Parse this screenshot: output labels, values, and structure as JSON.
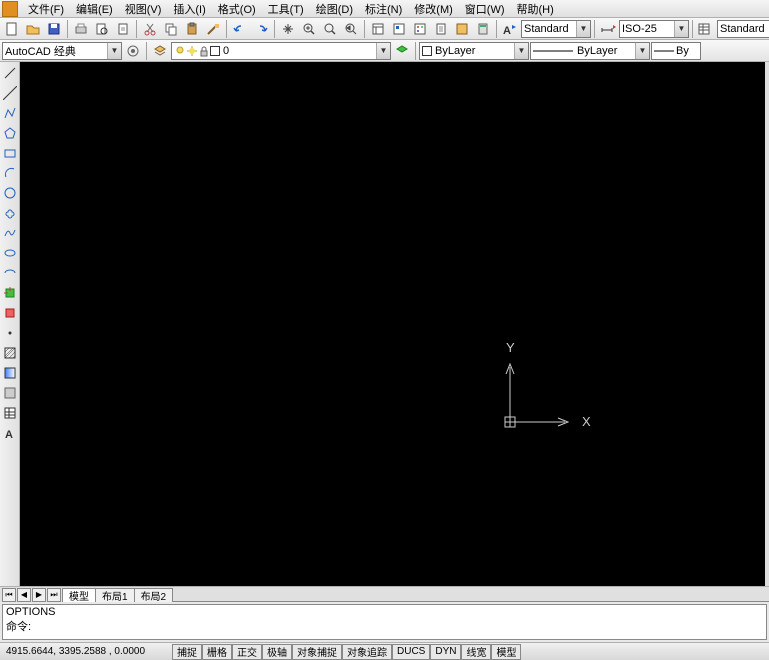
{
  "menu": {
    "items": [
      "文件(F)",
      "编辑(E)",
      "视图(V)",
      "插入(I)",
      "格式(O)",
      "工具(T)",
      "绘图(D)",
      "标注(N)",
      "修改(M)",
      "窗口(W)",
      "帮助(H)"
    ]
  },
  "workspace": {
    "label": "AutoCAD 经典"
  },
  "styles": {
    "text": "Standard",
    "dim": "ISO-25",
    "table": "Standard"
  },
  "layer": {
    "value": "0"
  },
  "props": {
    "color": "ByLayer",
    "linetype": "ByLayer",
    "lineweight": "By"
  },
  "ucs": {
    "x": "X",
    "y": "Y"
  },
  "tabs": {
    "active": "模型",
    "t1": "布局1",
    "t2": "布局2"
  },
  "command": {
    "line1": "OPTIONS",
    "prompt": "命令:"
  },
  "status": {
    "coords": "4915.6644, 3395.2588 , 0.0000",
    "btns": [
      "捕捉",
      "栅格",
      "正交",
      "极轴",
      "对象捕捉",
      "对象追踪",
      "DUCS",
      "DYN",
      "线宽",
      "模型"
    ]
  }
}
